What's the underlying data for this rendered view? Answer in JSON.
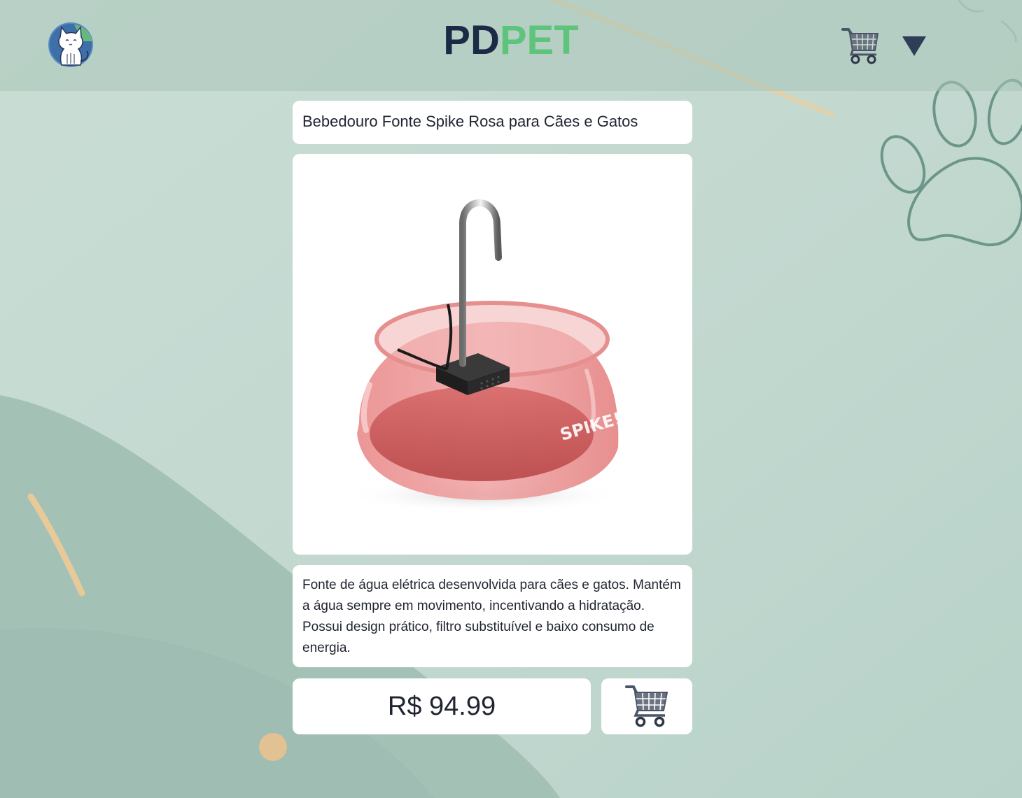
{
  "header": {
    "brand_part1": "PD",
    "brand_part2": "PET",
    "logo_icon": "cat-logo-icon",
    "cart_icon": "cart-icon",
    "dropdown_icon": "triangle-down-icon"
  },
  "product": {
    "title": "Bebedouro Fonte Spike Rosa para Cães e Gatos",
    "image_label": "SPIKE!",
    "description": "Fonte de água elétrica desenvolvida para cães e gatos. Mantém a água sempre em movimento, incentivando a hidratação. Possui design prático, filtro substituível e baixo consumo de energia.",
    "price": "R$ 94.99",
    "add_to_cart_icon": "cart-icon"
  },
  "colors": {
    "brand_dark": "#1b2a45",
    "brand_green": "#5ec47c",
    "background": "#c6dcd3"
  }
}
